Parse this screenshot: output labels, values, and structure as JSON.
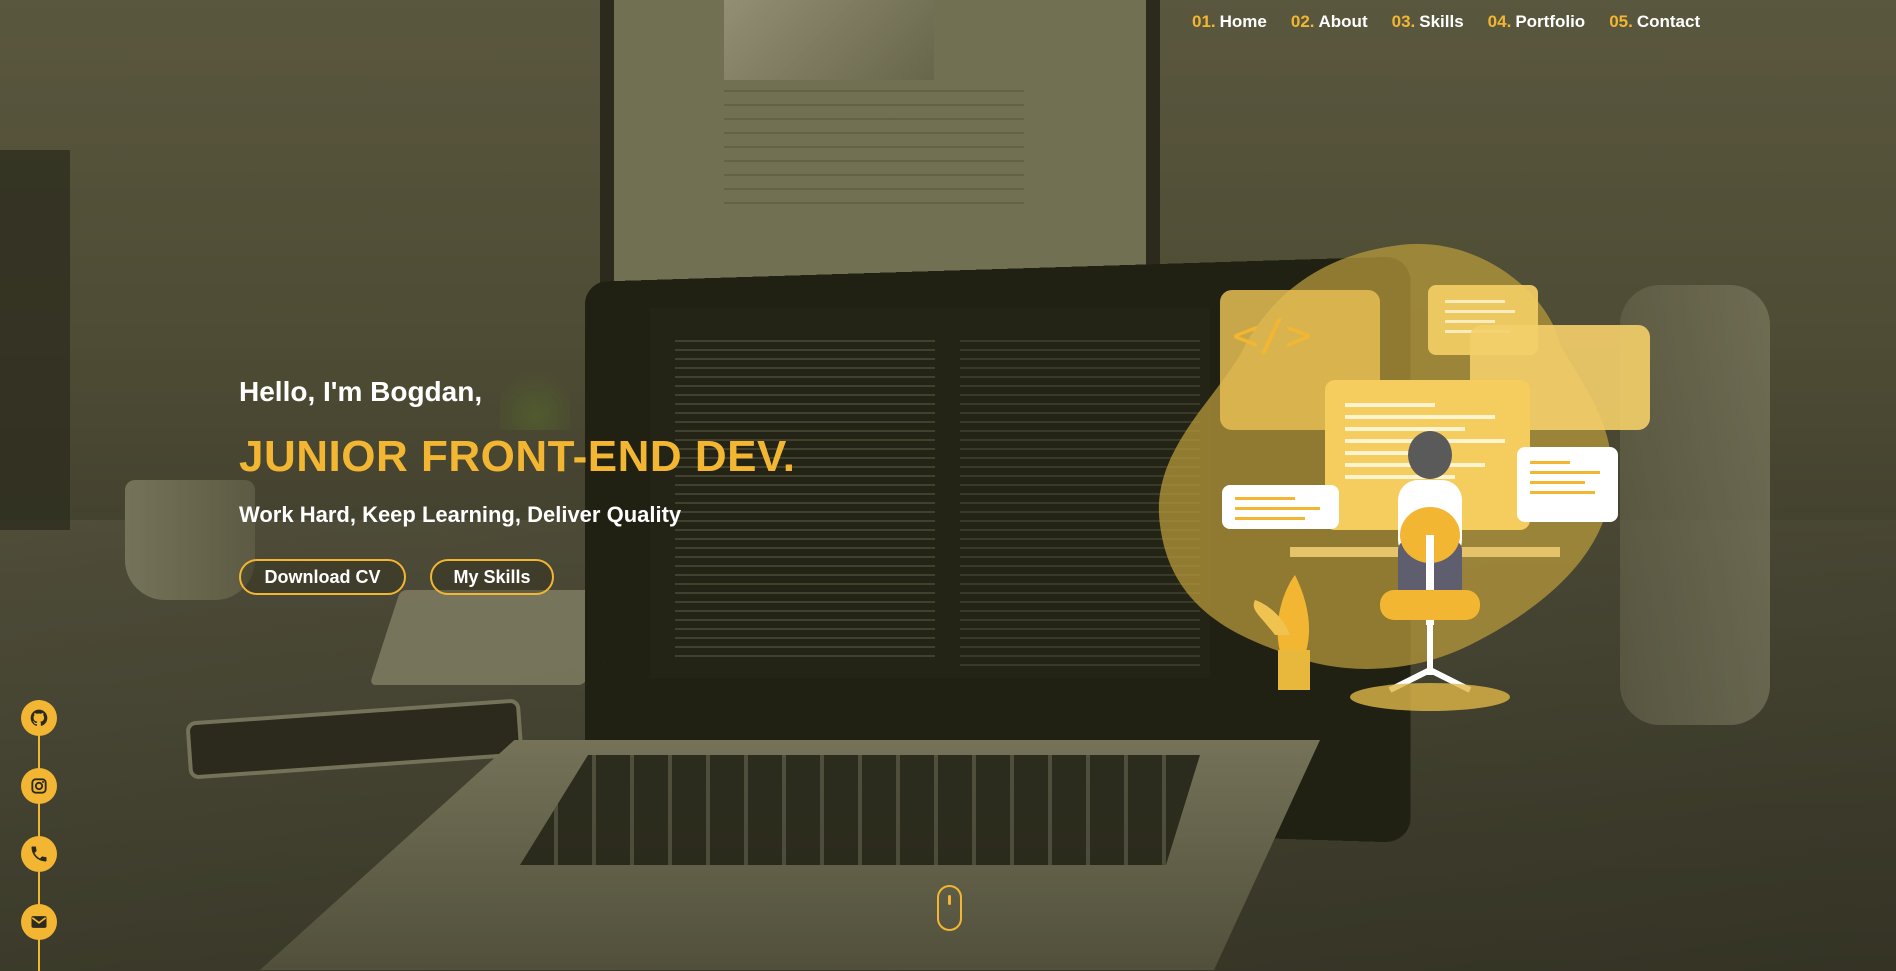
{
  "nav": {
    "items": [
      {
        "num": "01.",
        "label": "Home"
      },
      {
        "num": "02.",
        "label": "About"
      },
      {
        "num": "03.",
        "label": "Skills"
      },
      {
        "num": "04.",
        "label": "Portfolio"
      },
      {
        "num": "05.",
        "label": "Contact"
      }
    ]
  },
  "hero": {
    "greeting": "Hello, I'm Bogdan,",
    "title": "JUNIOR FRONT-END DEV.",
    "tagline": "Work Hard, Keep Learning, Deliver Quality",
    "buttons": {
      "download_cv": "Download CV",
      "my_skills": "My Skills"
    },
    "illustration_code_tag": "</>"
  },
  "social": {
    "icons": [
      "github-icon",
      "instagram-icon",
      "phone-icon",
      "email-icon"
    ]
  },
  "colors": {
    "accent": "#f2b632",
    "text": "#ffffff",
    "overlay": "#5a5742"
  }
}
